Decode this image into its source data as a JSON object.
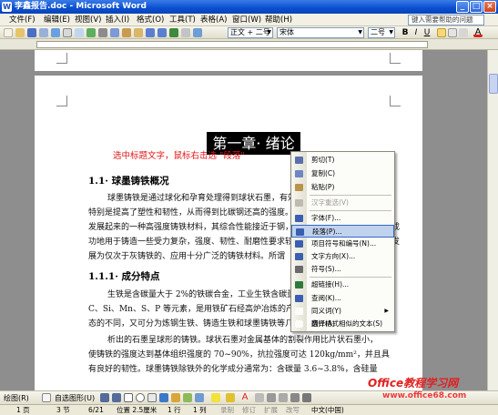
{
  "window": {
    "title": "李鑫报告.doc - Microsoft Word",
    "icon": "W",
    "controls": [
      "_",
      "□",
      "×"
    ]
  },
  "menubar": {
    "items": [
      "文件(F)",
      "编辑(E)",
      "视图(V)",
      "插入(I)",
      "格式(O)",
      "工具(T)",
      "表格(A)",
      "窗口(W)",
      "帮助(H)"
    ],
    "help_placeholder": "键入需要帮助的问题"
  },
  "toolbar": {
    "style": "正文 + 二号 -",
    "font": "宋体",
    "size": "二号",
    "bold": "B",
    "italic": "I",
    "underline": "U",
    "color_a": "A"
  },
  "document": {
    "chapter_title": "第一章· 绪论",
    "hint": "选中标题文字，鼠标右击选 \"段落\"",
    "h_1_1": "1.1· 球墨铸铁概况",
    "p1": [
      "球墨铸铁是通过球化和孕育处理得到球状石墨，有效地提高了铸铁的机械性能，",
      "特别是提高了塑性和韧性，从而得到比碳钢还高的强度。球墨铸铁是20世纪50年代",
      "发展起来的一种高强度铸铁材料，其综合性能接近于钢，正是基于其优异的性能，已成",
      "功地用于铸造一些受力复杂，强度、韧性、耐磨性要求较高的零件。球墨铸铁已迅速发",
      "展为仅次于灰铸铁的、应用十分广泛的铸铁材料。所谓"
    ],
    "h_1_1_1": "1.1.1· 成分特点",
    "p2": [
      "生铁是含碳量大于 2%的铁碳合金，工业生铁含碳量一般在2.5%-4%，并含",
      "C、Si、Mn、S、P 等元素，是用铁矿石经高炉冶炼的产品。根据生铁里碳存在形",
      "态的不同，又可分为炼钢生铁、铸造生铁和球墨铸铁等几种。"
    ],
    "p3": [
      "析出的石墨呈球形的铸铁。球状石墨对金属基体的割裂作用比片状石墨小，",
      "使铸铁的强度达到基体组织强度的 70~90%，抗拉强度可达 120kg/mm²，并且具",
      "有良好的韧性。球墨铸铁除铁外的化学成分通常为：含碳量 3.6~3.8%，含硅量"
    ]
  },
  "context_menu": {
    "items": [
      {
        "label": "剪切(T)",
        "icon": "scissors-icon",
        "color": "#5a6fa8",
        "disabled": false
      },
      {
        "label": "复制(C)",
        "icon": "copy-icon",
        "color": "#6d87c4",
        "disabled": false
      },
      {
        "label": "粘贴(P)",
        "icon": "paste-icon",
        "color": "#b8944a",
        "disabled": false
      },
      {
        "label": "汉字重选(V)",
        "icon": "reselect-icon",
        "color": "#bdbab0",
        "disabled": true
      },
      {
        "label": "字体(F)...",
        "icon": "font-icon",
        "color": "#3a5fb0",
        "disabled": false
      },
      {
        "label": "段落(P)...",
        "icon": "paragraph-icon",
        "color": "#3a5fb0",
        "disabled": false
      },
      {
        "label": "项目符号和编号(N)...",
        "icon": "bullets-icon",
        "color": "#3a5fb0",
        "disabled": false
      },
      {
        "label": "文字方向(X)...",
        "icon": "text-direction-icon",
        "color": "#3a5fb0",
        "disabled": false
      },
      {
        "label": "符号(S)...",
        "icon": "symbol-icon",
        "color": "#6a6a6a",
        "disabled": false
      },
      {
        "label": "超链接(H)...",
        "icon": "hyperlink-icon",
        "color": "#2f7a3a",
        "disabled": false
      },
      {
        "label": "查阅(K)...",
        "icon": "lookup-icon",
        "color": "#3a5fb0",
        "disabled": false
      },
      {
        "label": "同义词(Y)",
        "icon": "synonym-icon",
        "color": "#fcfcf9",
        "disabled": false,
        "submenu": true
      },
      {
        "label": "翻译(A)",
        "icon": "translate-icon",
        "color": "#3a5fb0",
        "disabled": false
      },
      {
        "label": "选择格式相似的文本(S)",
        "icon": "select-similar-icon",
        "color": "#fcfcf9",
        "disabled": false
      }
    ],
    "submenu_arrow": "▶"
  },
  "drawbar": {
    "draw": "绘图(R)",
    "autoshapes": "自选图形(U)"
  },
  "statusbar": {
    "page": "1 页",
    "section": "3 节",
    "page_of": "6/21",
    "position": "位置 2.5厘米",
    "line": "1 行",
    "column": "1 列",
    "rec": "录制",
    "trk": "修订",
    "ext": "扩展",
    "ovr": "改写",
    "language": "中文(中国)"
  },
  "watermark": {
    "text": "Office教程学习网",
    "url": "www.office68.com"
  }
}
